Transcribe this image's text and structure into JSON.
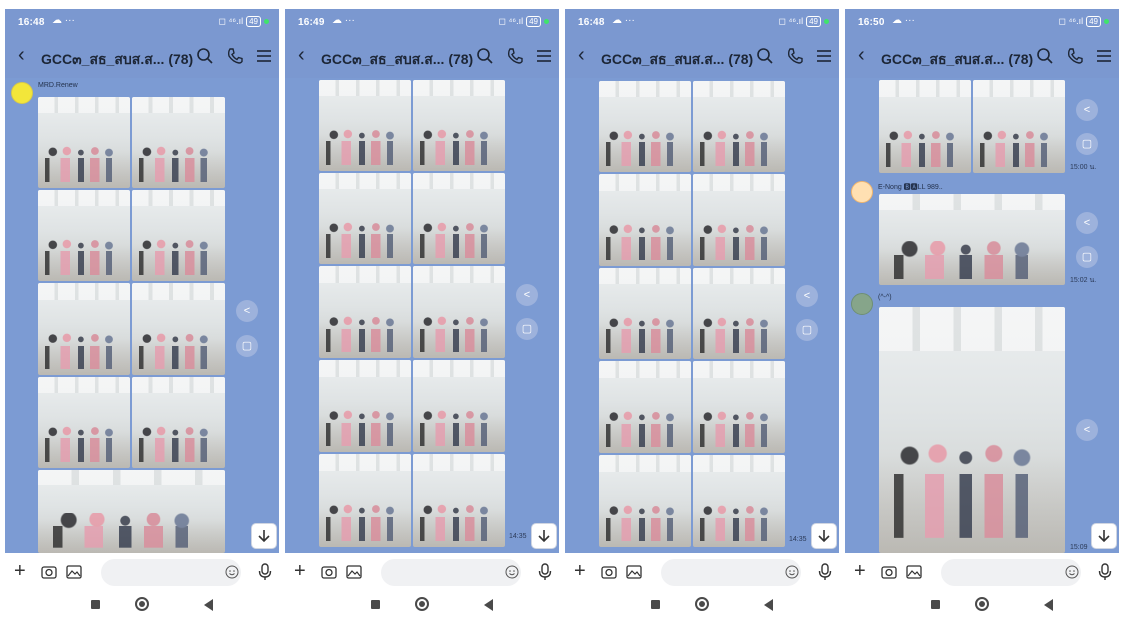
{
  "colors": {
    "header": "#7b98d0",
    "chat_background": "#7c9bd3",
    "status_dot": "#3fe46a"
  },
  "common": {
    "chat_title": "GCC๓_สธ_สบส.ส... (78)",
    "status_indicator": "◻ ⁴⁶.ıl",
    "battery": "49",
    "status_left": "☁ ···"
  },
  "phones": [
    {
      "status_time": "16:48",
      "sender_name": "MRD.Renew"
    },
    {
      "status_time": "16:49",
      "photo_time": "14:35"
    },
    {
      "status_time": "16:48",
      "photo_time": "14:35"
    },
    {
      "status_time": "16:50",
      "msg_time_1": "15:00 น.",
      "sender_name_2": "E-Nong 🅱🅰LL 989..",
      "msg_time_2": "15:02 น.",
      "sender_name_3": "(^-^)",
      "msg_time_3": "15:09"
    }
  ]
}
